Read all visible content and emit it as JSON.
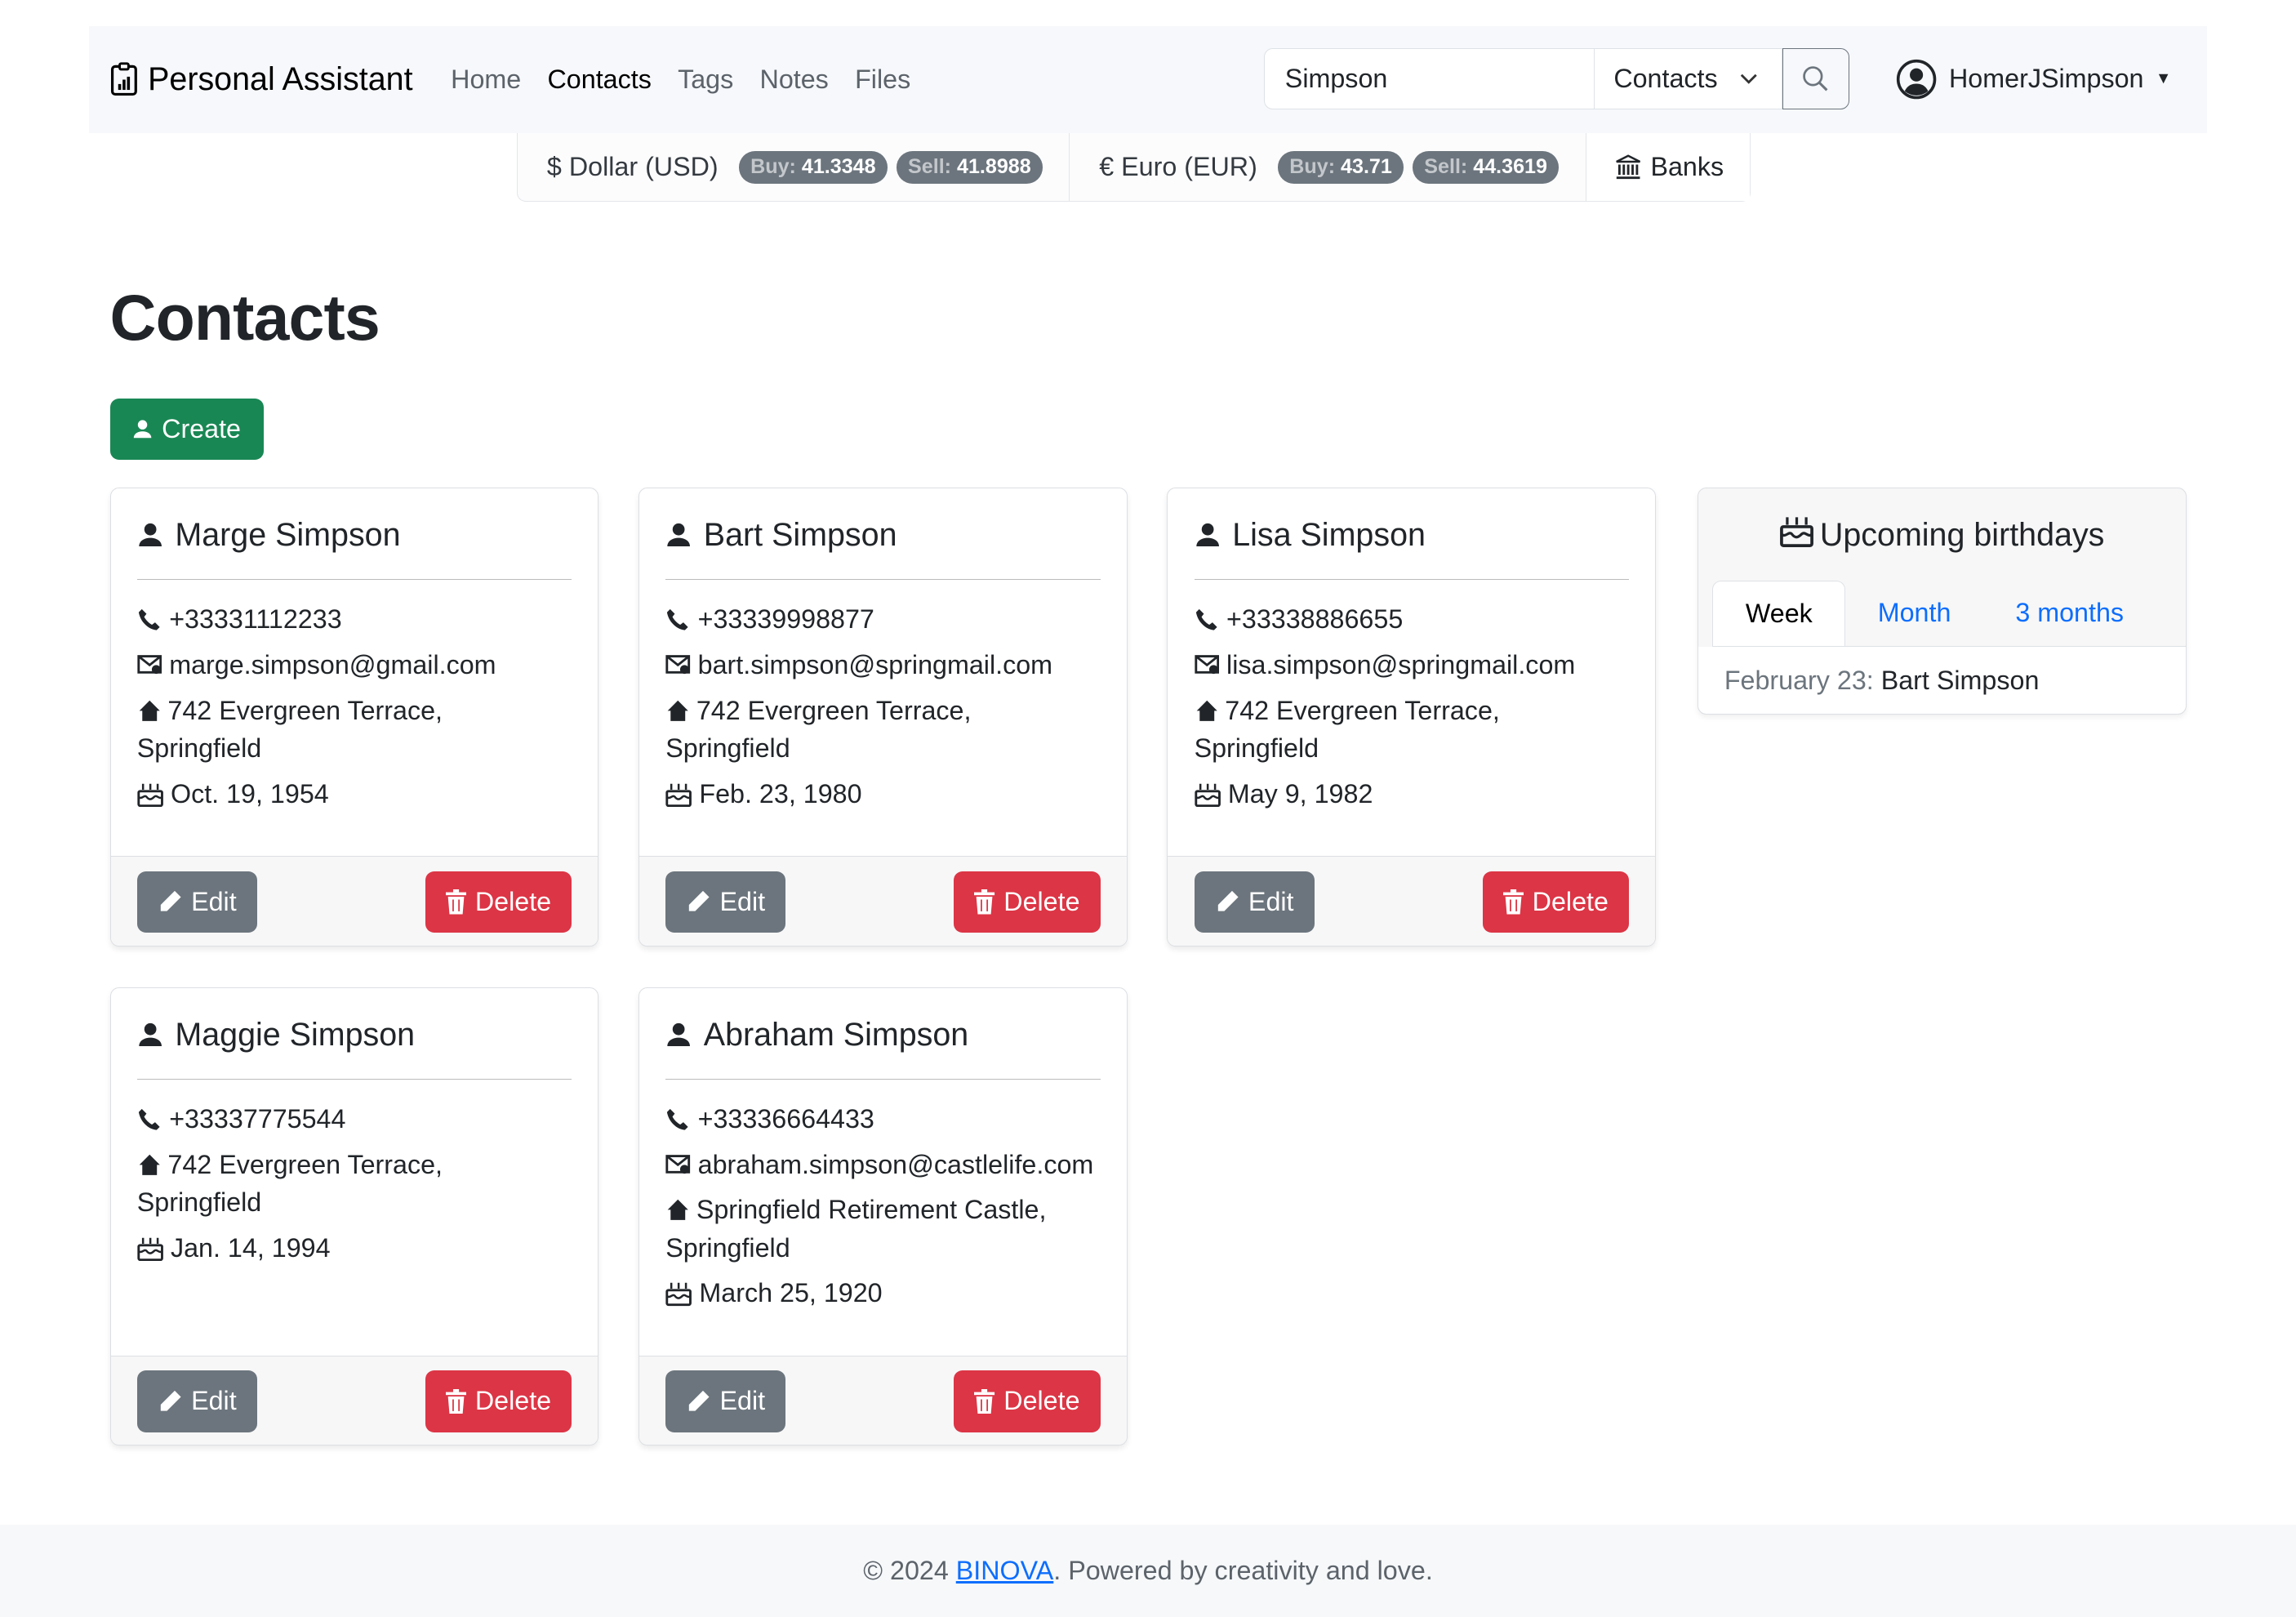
{
  "navbar": {
    "brand": "Personal Assistant",
    "links": [
      "Home",
      "Contacts",
      "Tags",
      "Notes",
      "Files"
    ],
    "active": "Contacts",
    "search_value": "Simpson",
    "search_scope": "Contacts",
    "username": "HomerJSimpson"
  },
  "currency": {
    "usd": {
      "label": "$ Dollar (USD)",
      "buy_label": "Buy:",
      "buy": "41.3348",
      "sell_label": "Sell:",
      "sell": "41.8988"
    },
    "eur": {
      "label": "€ Euro (EUR)",
      "buy_label": "Buy:",
      "buy": "43.71",
      "sell_label": "Sell:",
      "sell": "44.3619"
    },
    "banks": "Banks"
  },
  "page": {
    "title": "Contacts",
    "create": "Create"
  },
  "contacts": [
    {
      "name": "Marge Simpson",
      "phone": "+33331112233",
      "email": "marge.simpson@gmail.com",
      "address": "742 Evergreen Terrace, Springfield",
      "birthday": "Oct. 19, 1954"
    },
    {
      "name": "Bart Simpson",
      "phone": "+33339998877",
      "email": "bart.simpson@springmail.com",
      "address": "742 Evergreen Terrace, Springfield",
      "birthday": "Feb. 23, 1980"
    },
    {
      "name": "Lisa Simpson",
      "phone": "+33338886655",
      "email": "lisa.simpson@springmail.com",
      "address": "742 Evergreen Terrace, Springfield",
      "birthday": "May 9, 1982"
    },
    {
      "name": "Maggie Simpson",
      "phone": "+33337775544",
      "address": "742 Evergreen Terrace, Springfield",
      "birthday": "Jan. 14, 1994"
    },
    {
      "name": "Abraham Simpson",
      "phone": "+33336664433",
      "email": "abraham.simpson@castlelife.com",
      "address": "Springfield Retirement Castle, Springfield",
      "birthday": "March 25, 1920"
    }
  ],
  "buttons": {
    "edit": "Edit",
    "delete": "Delete"
  },
  "birthdays": {
    "title": "Upcoming birthdays",
    "tabs": [
      "Week",
      "Month",
      "3 months"
    ],
    "active": "Week",
    "entry_date": "February 23:",
    "entry_name": "Bart Simpson"
  },
  "footer": {
    "prefix": "© 2024 ",
    "link": "BINOVA",
    "suffix": ". Powered by creativity and love."
  }
}
